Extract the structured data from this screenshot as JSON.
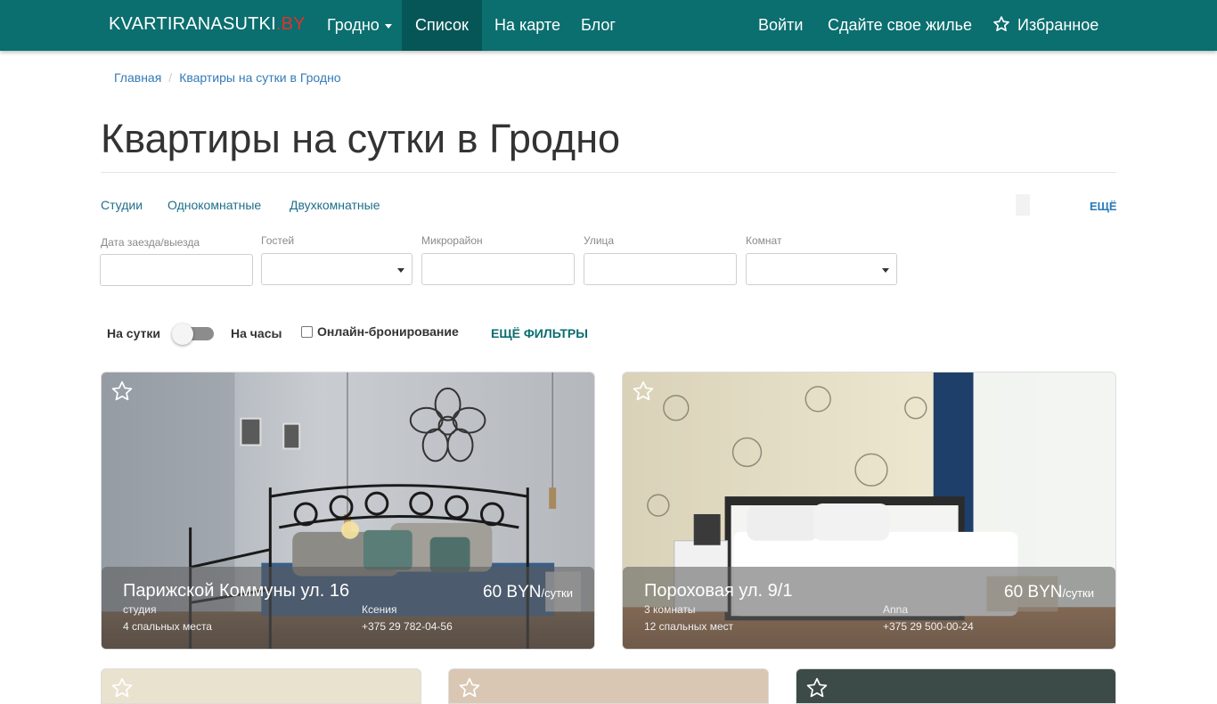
{
  "navbar": {
    "brand_main": "KVARTIRANASUTKI",
    "brand_tld": ".BY",
    "city": "Гродно",
    "list": "Список",
    "map": "На карте",
    "blog": "Блог",
    "login": "Войти",
    "rent_out": "Сдайте свое жилье",
    "favorites": "Избранное"
  },
  "breadcrumb": {
    "home": "Главная",
    "current": "Квартиры на сутки в Гродно"
  },
  "title": "Квартиры на сутки в Гродно",
  "quick_links": {
    "studios": "Студии",
    "one_room": "Однокомнатные",
    "two_room": "Двухкомнатные",
    "more": "ЕЩЁ"
  },
  "filters": {
    "dates_label": "Дата заезда/выезда",
    "dates_value": "",
    "guests_label": "Гостей",
    "guests_value": "",
    "district_label": "Микрорайон",
    "district_value": "",
    "street_label": "Улица",
    "street_value": "",
    "rooms_label": "Комнат",
    "rooms_value": "",
    "per_day": "На сутки",
    "per_hour": "На часы",
    "online_booking": "Онлайн-бронирование",
    "more_filters": "ЕЩЁ ФИЛЬТРЫ"
  },
  "listings": [
    {
      "address": "Парижской Коммуны ул. 16",
      "type": "студия",
      "beds": "4 спальных места",
      "host": "Ксения",
      "phone": "+375 29 782-04-56",
      "price": "60 BYN",
      "per": "/сутки"
    },
    {
      "address": "Пороховая ул. 9/1",
      "type": "3 комнаты",
      "beds": "12 спальных мест",
      "host": "Anna",
      "phone": "+375 29 500-00-24",
      "price": "60 BYN",
      "per": "/сутки"
    }
  ],
  "colors": {
    "navbar": "#0b6e6f",
    "navbar_active": "#075657",
    "brand_tld": "#e2322b",
    "link": "#337ab7"
  }
}
